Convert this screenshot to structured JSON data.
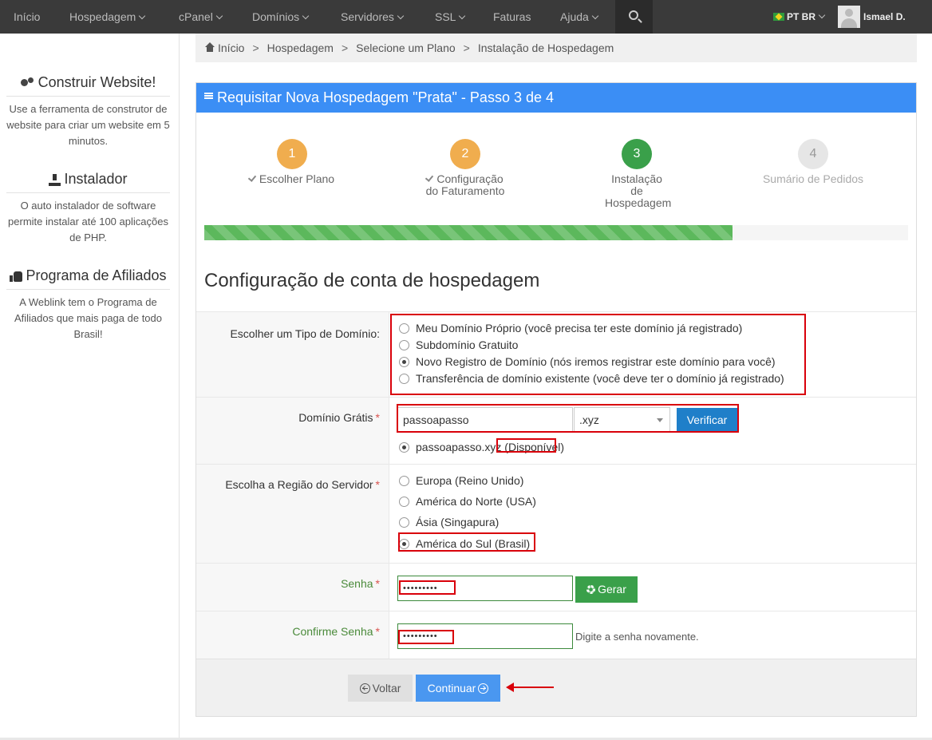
{
  "nav": {
    "items": [
      {
        "label": "Início",
        "caret": false
      },
      {
        "label": "Hospedagem",
        "caret": true
      },
      {
        "label": "cPanel",
        "caret": true
      },
      {
        "label": "Domínios",
        "caret": true
      },
      {
        "label": "Servidores",
        "caret": true
      },
      {
        "label": "SSL",
        "caret": true
      },
      {
        "label": "Faturas",
        "caret": false
      },
      {
        "label": "Ajuda",
        "caret": true
      }
    ],
    "language": "PT BR",
    "user": "Ismael D."
  },
  "sidebar": {
    "blocks": [
      {
        "title": "Construir Website!",
        "icon": "gears-icon",
        "text": "Use a ferramenta de construtor de website para criar um website em 5 minutos."
      },
      {
        "title": "Instalador",
        "icon": "download-icon",
        "text": "O auto instalador de software permite instalar até 100 aplicações de PHP."
      },
      {
        "title": "Programa de Afiliados",
        "icon": "thumbs-up-icon",
        "text": "A Weblink tem o Programa de Afiliados que mais paga de todo Brasil!"
      }
    ]
  },
  "breadcrumb": [
    "Início",
    "Hospedagem",
    "Selecione um Plano",
    "Instalação de Hospedagem"
  ],
  "panel": {
    "title": "Requisitar Nova Hospedagem \"Prata\" - Passo 3 de 4"
  },
  "steps": [
    {
      "number": "1",
      "label": "Escolher Plano",
      "done": true,
      "color": "#f0ad4e"
    },
    {
      "number": "2",
      "label": "Configuração do Faturamento",
      "done": true,
      "color": "#f0ad4e"
    },
    {
      "number": "3",
      "label": "Instalação de Hospedagem",
      "done": false,
      "color": "#3aa04a"
    },
    {
      "number": "4",
      "label": "Sumário de Pedidos",
      "done": false,
      "color": "#e6e6e6"
    }
  ],
  "progress": {
    "fraction": 0.75
  },
  "form": {
    "section_title": "Configuração de conta de hospedagem",
    "domain_type": {
      "label": "Escolher um Tipo de Domínio:",
      "options": [
        {
          "text": "Meu Domínio Próprio (você precisa ter este domínio já registrado)",
          "checked": false
        },
        {
          "text": "Subdomínio Gratuito",
          "checked": false
        },
        {
          "text": "Novo Registro de Domínio (nós iremos registrar este domínio para você)",
          "checked": true
        },
        {
          "text": "Transferência de domínio existente (você deve ter o domínio já registrado)",
          "checked": false
        }
      ]
    },
    "free_domain": {
      "label": "Domínio Grátis",
      "value": "passoapasso",
      "tld": ".xyz",
      "button": "Verificar",
      "result_domain": "passoapasso.xyz",
      "result_status": "Disponível"
    },
    "region": {
      "label": "Escolha a Região do Servidor",
      "options": [
        {
          "text": "Europa (Reino Unido)",
          "checked": false
        },
        {
          "text": "América do Norte (USA)",
          "checked": false
        },
        {
          "text": "Ásia (Singapura)",
          "checked": false
        },
        {
          "text": "América do Sul (Brasil)",
          "checked": true
        }
      ]
    },
    "password": {
      "label": "Senha",
      "value": "•••••••••",
      "generate_button": "Gerar"
    },
    "confirm_password": {
      "label": "Confirme Senha",
      "value": "•••••••••",
      "hint": "Digite a senha novamente."
    },
    "back_button": "Voltar",
    "continue_button": "Continuar"
  },
  "colors": {
    "nav_bg": "#3a3a3a",
    "panel_heading": "#3b8ef5",
    "highlight": "#d9000a",
    "step_done": "#f0ad4e",
    "step_current": "#3aa04a"
  }
}
